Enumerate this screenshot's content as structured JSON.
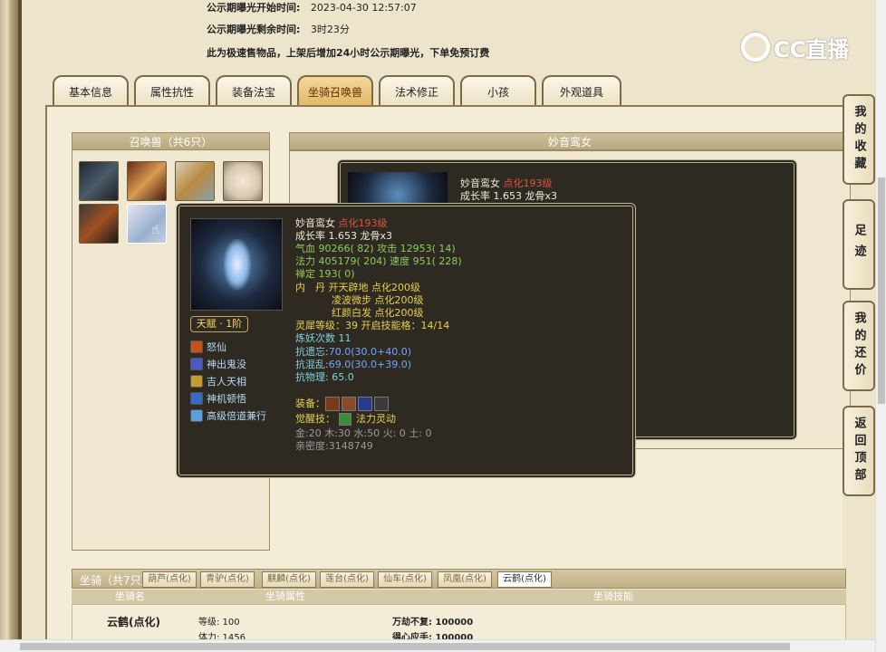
{
  "info": {
    "start_label": "公示期曝光开始时间:",
    "start_value": "2023-04-30 12:57:07",
    "remain_label": "公示期曝光剩余时间:",
    "remain_value": "3时23分",
    "notice": "此为极速售物品，上架后增加24小时公示期曝光，下单免预订费"
  },
  "logo": {
    "text": "CC直播"
  },
  "tabs": [
    "基本信息",
    "属性抗性",
    "装备法宝",
    "坐骑召唤兽",
    "法术修正",
    "小孩",
    "外观道具"
  ],
  "active_tab": 3,
  "pet_list": {
    "title": "召唤兽（共6只）"
  },
  "right_panel": {
    "title": "妙音鸾女"
  },
  "behind_card": {
    "name": "妙音鸾女",
    "level": "点化193级",
    "growth": "成长率 1.653 龙骨x3"
  },
  "popup": {
    "name": "妙音鸾女",
    "level": "点化193级",
    "growth": "成长率 1.653 龙骨x3",
    "hp_label": "气血",
    "hp_value": "90266( 82)",
    "atk_label": "攻击",
    "atk_value": "12953( 14)",
    "mp_label": "法力",
    "mp_value": "405179( 204)",
    "spd_label": "速度",
    "spd_value": "951( 228)",
    "zen_label": "禅定",
    "zen_value": "193( 0)",
    "dan_label": "内　丹",
    "dan1": "开天辟地 点化200级",
    "dan2": "凌波微步 点化200级",
    "dan3": "红颜白发 点化200级",
    "soul_label": "灵犀等级：",
    "soul_value": "39 开启技能格：14/14",
    "refine_label": "炼妖次数",
    "refine_value": "11",
    "res1_label": "抗遗忘:",
    "res1_value": "70.0(30.0+40.0)",
    "res2_label": "抗混乱:",
    "res2_value": "69.0(30.0+39.0)",
    "res3_label": "抗物理:",
    "res3_value": "65.0",
    "equip_label": "装备：",
    "awaken_label": "觉醒技：",
    "awaken_value": "法力灵动",
    "elements": "金:20 木:30 水:50 火: 0 土: 0",
    "intimacy": "亲密度:3148749",
    "talent": "天赋 · 1阶",
    "skills": [
      "怒仙",
      "神出鬼没",
      "吉人天相",
      "神机顿悟",
      "高级倍道兼行"
    ]
  },
  "side_buttons": [
    "我的收藏",
    "足迹",
    "我的还价",
    "返回顶部"
  ],
  "mount": {
    "title": "坐骑（共7只）",
    "tabs": [
      "葫芦(点化)",
      "青驴(点化)",
      "麒麟(点化)",
      "莲台(点化)",
      "仙车(点化)",
      "凤凰(点化)",
      "云鹤(点化)"
    ],
    "active_tab": 6,
    "headers": [
      "坐骑名",
      "坐骑属性",
      "坐骑技能"
    ],
    "name": "云鹤(点化)",
    "attr1": "等级: 100",
    "attr2": "体力: 1456",
    "skill1": "万劫不复: 100000",
    "skill2": "得心应手: 100000"
  }
}
